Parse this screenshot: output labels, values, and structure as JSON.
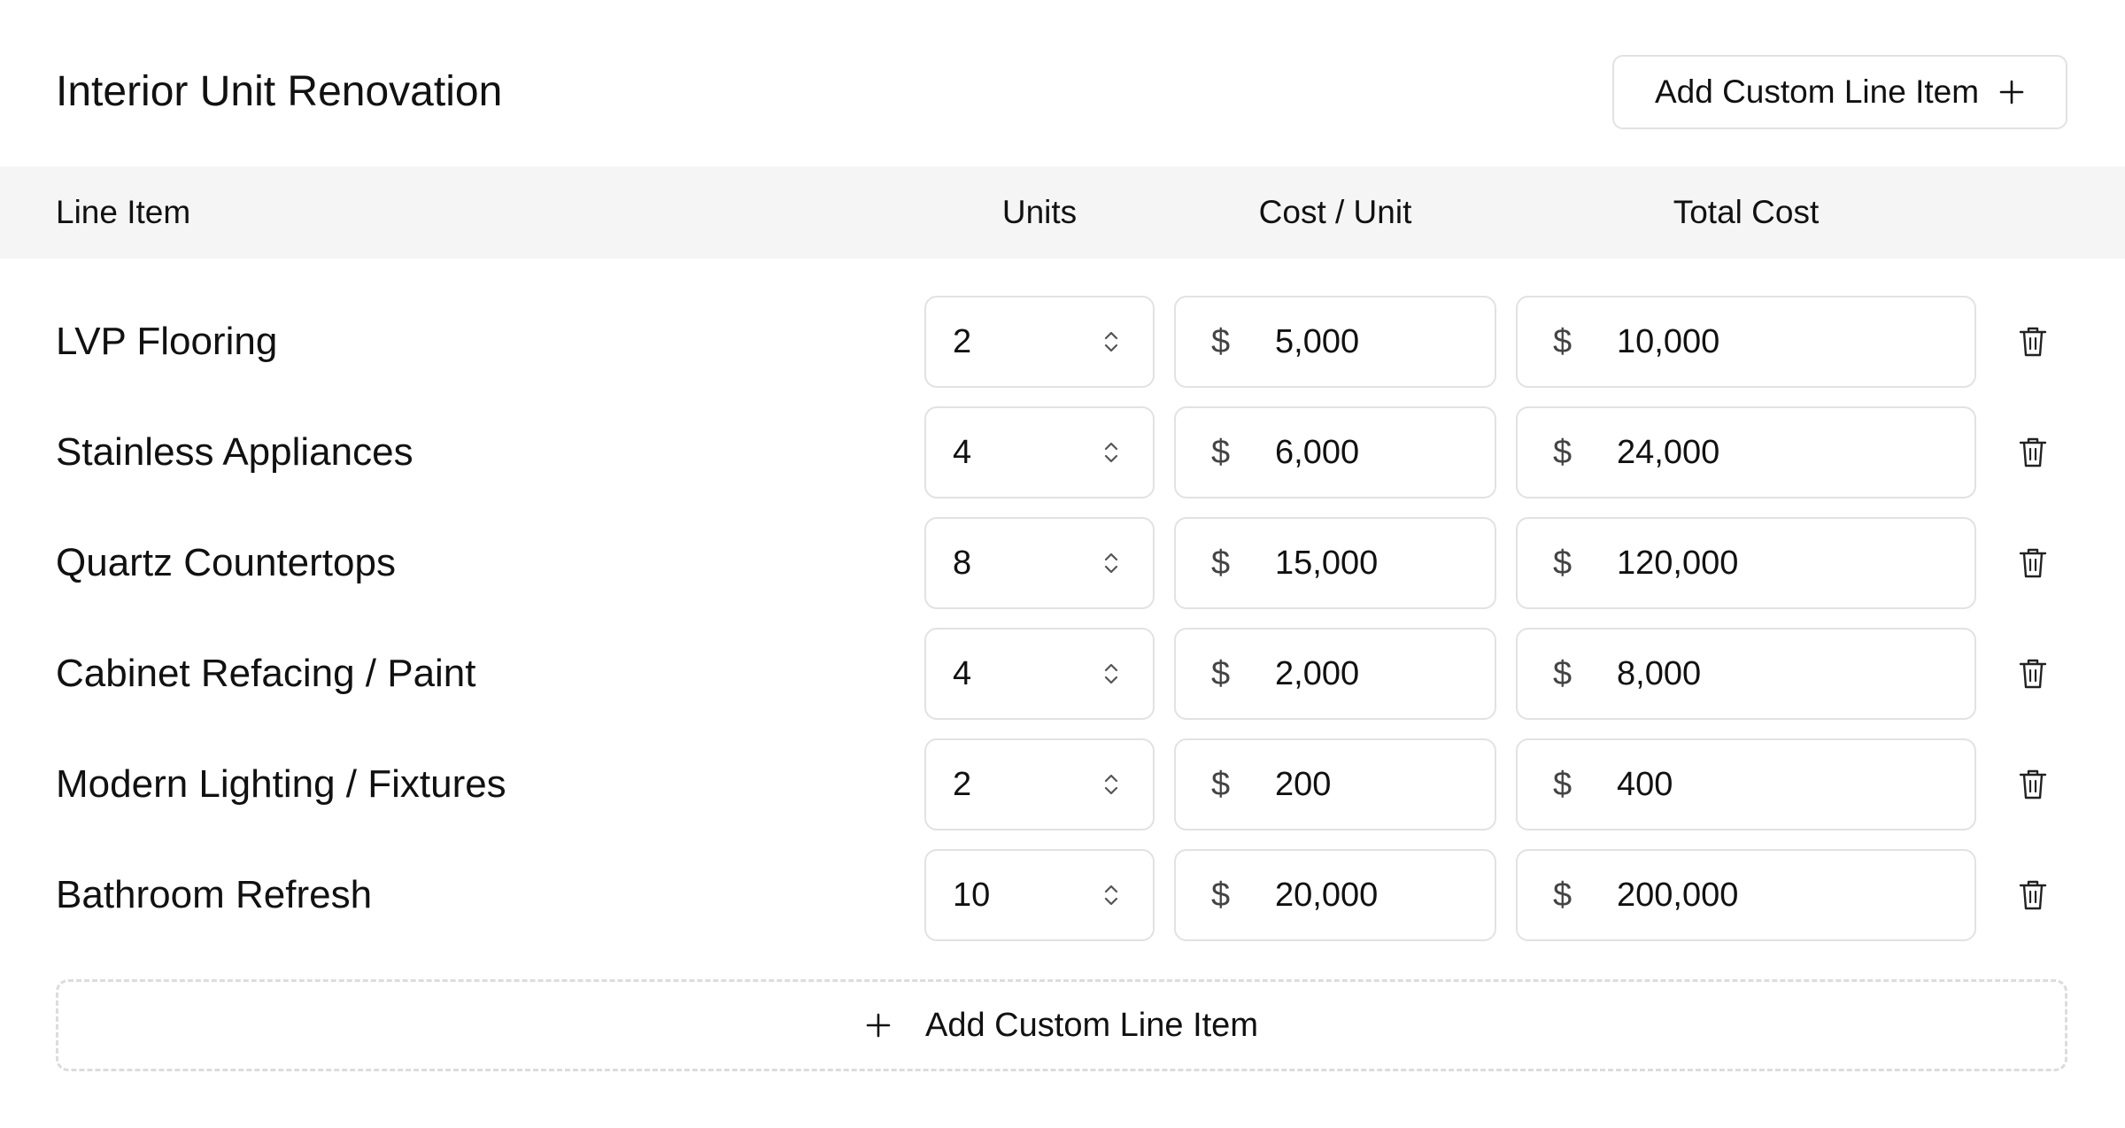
{
  "title": "Interior Unit Renovation",
  "add_button_label": "Add Custom Line Item",
  "columns": {
    "item": "Line Item",
    "units": "Units",
    "cost_per_unit": "Cost / Unit",
    "total_cost": "Total Cost"
  },
  "currency_symbol": "$",
  "rows": [
    {
      "label": "LVP Flooring",
      "units": "2",
      "cost": "5,000",
      "total": "10,000"
    },
    {
      "label": "Stainless Appliances",
      "units": "4",
      "cost": "6,000",
      "total": "24,000"
    },
    {
      "label": "Quartz Countertops",
      "units": "8",
      "cost": "15,000",
      "total": "120,000"
    },
    {
      "label": "Cabinet Refacing / Paint",
      "units": "4",
      "cost": "2,000",
      "total": "8,000"
    },
    {
      "label": "Modern Lighting / Fixtures",
      "units": "2",
      "cost": "200",
      "total": "400"
    },
    {
      "label": "Bathroom Refresh",
      "units": "10",
      "cost": "20,000",
      "total": "200,000"
    }
  ],
  "icons": {
    "add": "plus-icon",
    "stepper": "chevron-up-down-icon",
    "delete": "trash-icon"
  }
}
